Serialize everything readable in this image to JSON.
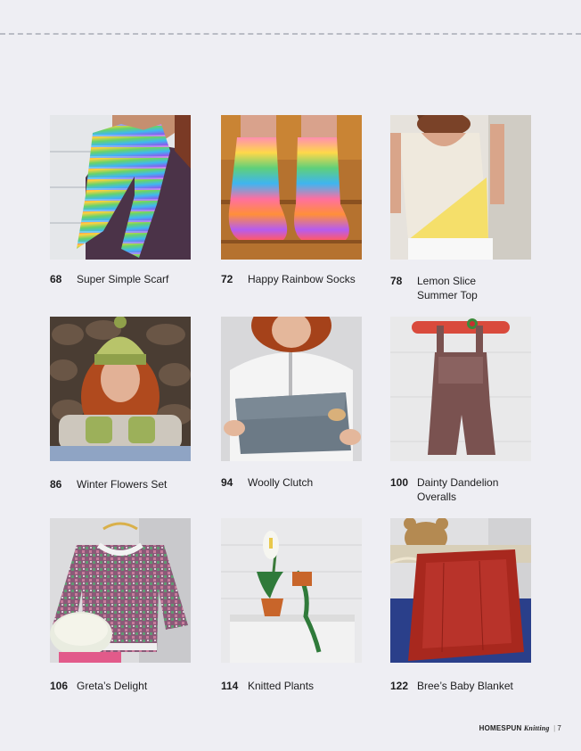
{
  "entries": [
    {
      "page": "68",
      "title": "Super Simple Scarf",
      "photo": "scarf-photo"
    },
    {
      "page": "72",
      "title": "Happy Rainbow Socks",
      "photo": "socks-photo"
    },
    {
      "page": "78",
      "title": "Lemon Slice Summer Top",
      "photo": "top-photo"
    },
    {
      "page": "86",
      "title": "Winter Flowers Set",
      "photo": "hat-mittens-photo"
    },
    {
      "page": "94",
      "title": "Woolly Clutch",
      "photo": "clutch-photo"
    },
    {
      "page": "100",
      "title": "Dainty Dandelion Overalls",
      "photo": "overalls-photo"
    },
    {
      "page": "106",
      "title": "Greta’s Delight",
      "photo": "sweater-photo"
    },
    {
      "page": "114",
      "title": "Knitted Plants",
      "photo": "plants-photo"
    },
    {
      "page": "122",
      "title": "Bree’s Baby Blanket",
      "photo": "blanket-photo"
    }
  ],
  "footer": {
    "brand": "HOMESPUN",
    "magazine": "Knitting",
    "separator": "|",
    "page_number": "7"
  }
}
